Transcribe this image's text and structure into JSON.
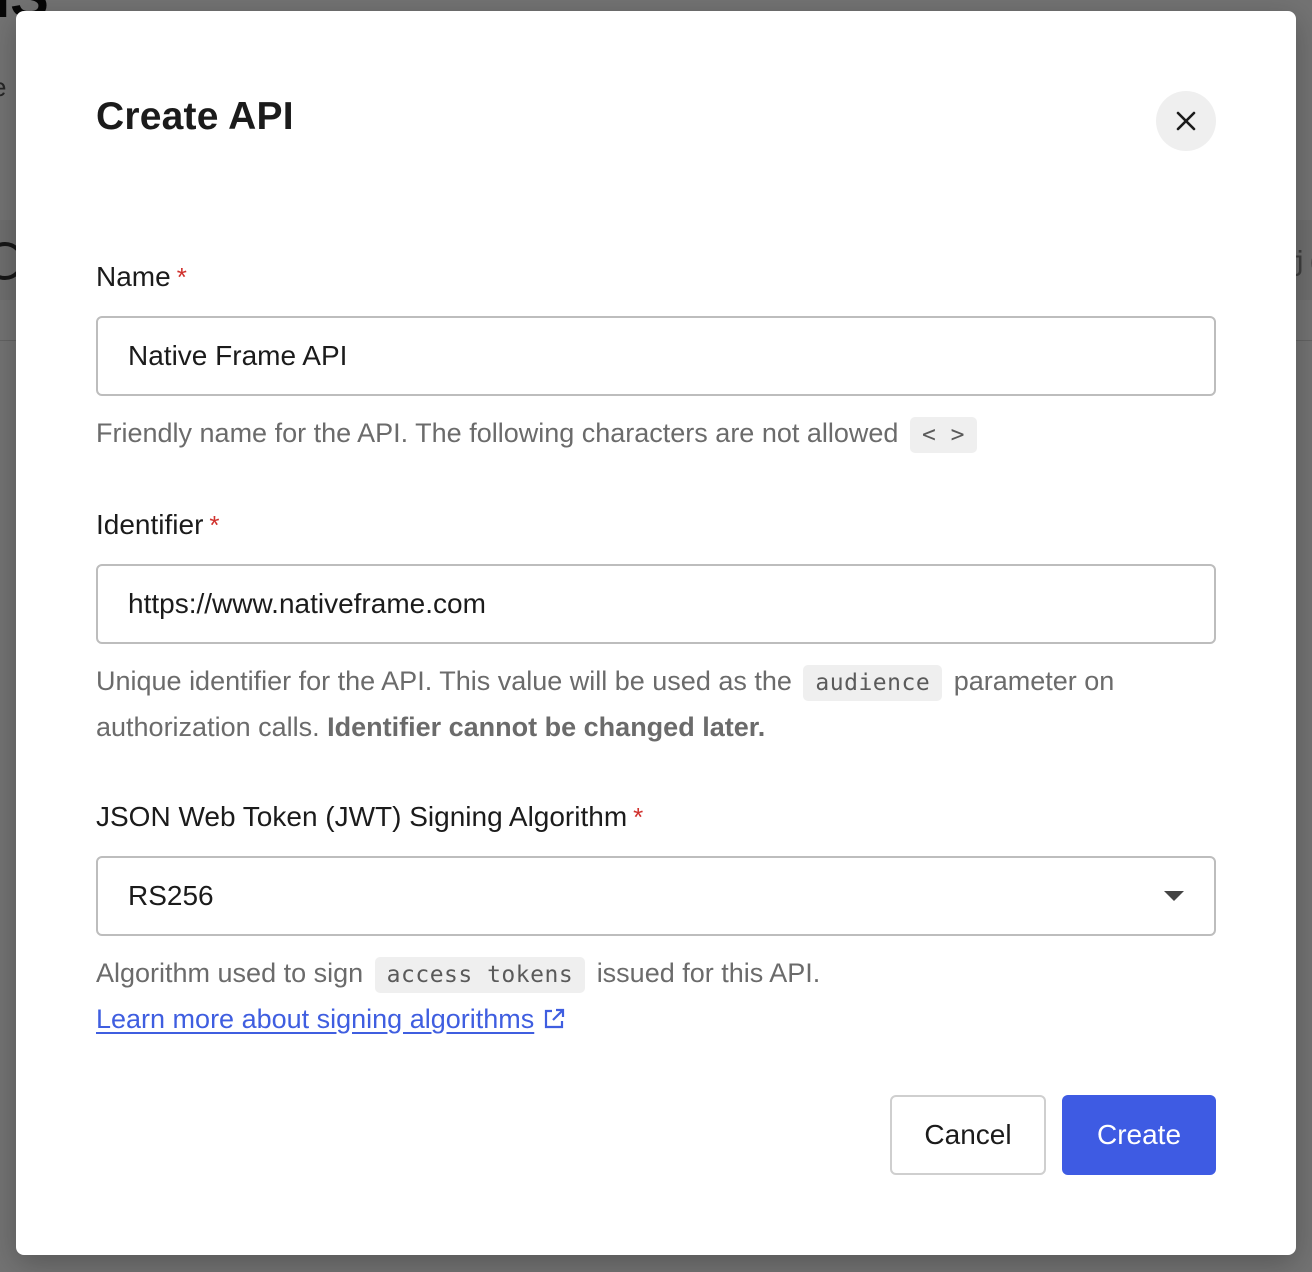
{
  "modal": {
    "title": "Create API",
    "close_label": "×"
  },
  "fields": {
    "name": {
      "label": "Name",
      "required_mark": "*",
      "value": "Native Frame API",
      "help": "Friendly name for the API. The following characters are not allowed",
      "help_code": "< >"
    },
    "identifier": {
      "label": "Identifier",
      "required_mark": "*",
      "value": "https://www.nativeframe.com",
      "help_before": "Unique identifier for the API. This value will be used as the",
      "help_code": "audience",
      "help_after": "parameter on authorization calls.",
      "help_bold": "Identifier cannot be changed later."
    },
    "algorithm": {
      "label": "JSON Web Token (JWT) Signing Algorithm",
      "required_mark": "*",
      "selected": "RS256",
      "help_before": "Algorithm used to sign",
      "help_code": "access tokens",
      "help_after": "issued for this API.",
      "link_text": "Learn more about signing algorithms"
    }
  },
  "actions": {
    "cancel_label": "Cancel",
    "create_label": "Create"
  },
  "colors": {
    "primary": "#3e5be3",
    "required": "#d0312d",
    "link": "#3f5ee0"
  },
  "icons": {
    "close": "close-icon",
    "caret": "chevron-down-icon",
    "external": "external-link-icon"
  }
}
